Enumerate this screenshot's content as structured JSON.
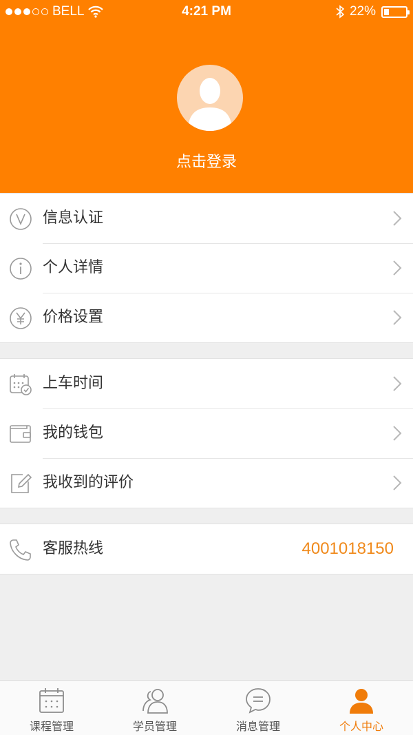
{
  "status_bar": {
    "carrier": "BELL",
    "time": "4:21 PM",
    "battery": "22%",
    "battery_level": 0.22
  },
  "header": {
    "login_text": "点击登录",
    "background_color": "#ff8000",
    "avatar_icon": "default-user-avatar-icon"
  },
  "menu": {
    "group1": [
      {
        "label": "信息认证",
        "icon": "verified-v-icon"
      },
      {
        "label": "个人详情",
        "icon": "info-icon"
      },
      {
        "label": "价格设置",
        "icon": "yuan-icon"
      }
    ],
    "group2": [
      {
        "label": "上车时间",
        "icon": "calendar-clock-icon"
      },
      {
        "label": "我的钱包",
        "icon": "wallet-icon"
      },
      {
        "label": "我收到的评价",
        "icon": "edit-icon"
      }
    ],
    "group3": [
      {
        "label": "客服热线",
        "icon": "phone-icon",
        "value": "4001018150"
      }
    ]
  },
  "tabbar": {
    "tabs": [
      {
        "label": "课程管理",
        "icon": "calendar-icon",
        "active": false
      },
      {
        "label": "学员管理",
        "icon": "users-icon",
        "active": false
      },
      {
        "label": "消息管理",
        "icon": "chat-bubble-icon",
        "active": false
      },
      {
        "label": "个人中心",
        "icon": "person-icon",
        "active": true
      }
    ],
    "active_color": "#f07c0a"
  }
}
